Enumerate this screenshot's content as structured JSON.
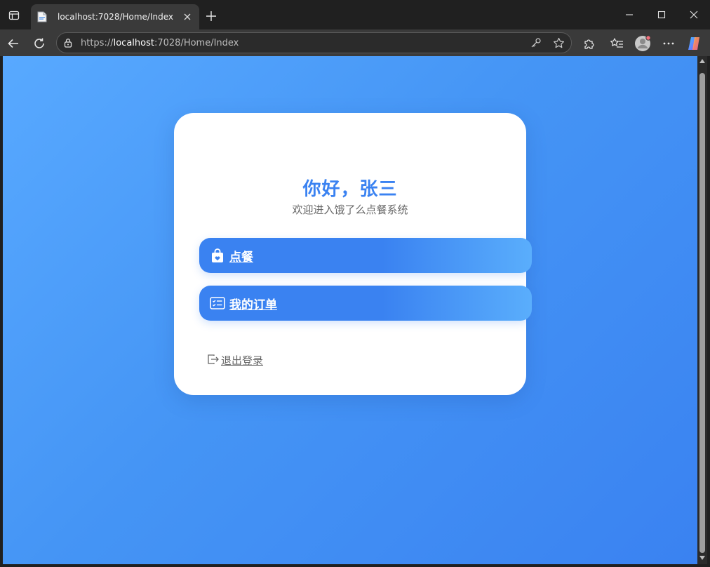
{
  "browser": {
    "tab_title": "localhost:7028/Home/Index",
    "url_scheme": "https://",
    "url_host": "localhost",
    "url_rest": ":7028/Home/Index"
  },
  "page": {
    "greeting": "你好，张三",
    "subtitle": "欢迎进入饿了么点餐系统",
    "menu": [
      {
        "label": "点餐",
        "icon": "shopping-bag-icon"
      },
      {
        "label": "我的订单",
        "icon": "order-list-icon"
      }
    ],
    "logout_label": "退出登录",
    "logout_icon": "logout-icon"
  },
  "colors": {
    "accent": "#3a82f1",
    "background_start": "#58a9ff",
    "background_end": "#3a82f1"
  }
}
